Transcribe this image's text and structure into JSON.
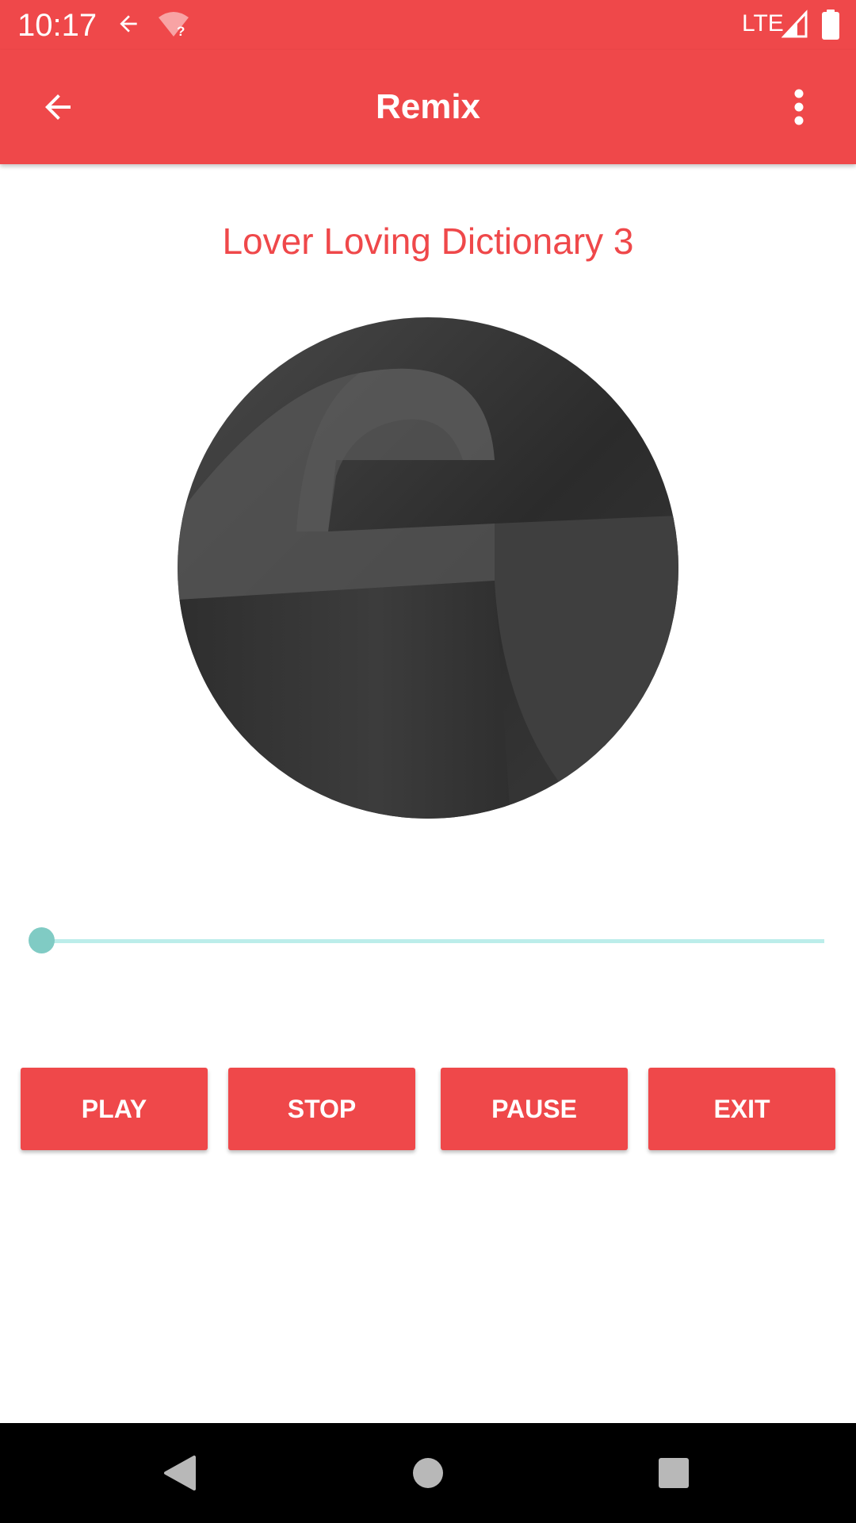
{
  "status_bar": {
    "time": "10:17",
    "network": "LTE",
    "icons": [
      "back-arrow-icon",
      "wifi-unknown-icon",
      "signal-icon",
      "battery-icon"
    ]
  },
  "app_bar": {
    "title": "Remix",
    "icons": [
      "back-arrow-icon",
      "more-vert-icon"
    ]
  },
  "player": {
    "song_title": "Lover Loving Dictionary 3",
    "progress": 0
  },
  "controls": {
    "play_label": "PLAY",
    "stop_label": "STOP",
    "pause_label": "PAUSE",
    "exit_label": "EXIT"
  },
  "nav_bar": {
    "icons": [
      "back-triangle-icon",
      "home-circle-icon",
      "recents-square-icon"
    ]
  },
  "colors": {
    "accent": "#EF484A",
    "seek_track": "#BCEDEA",
    "seek_thumb": "#80CBC4",
    "nav_bar_bg": "#000000"
  }
}
